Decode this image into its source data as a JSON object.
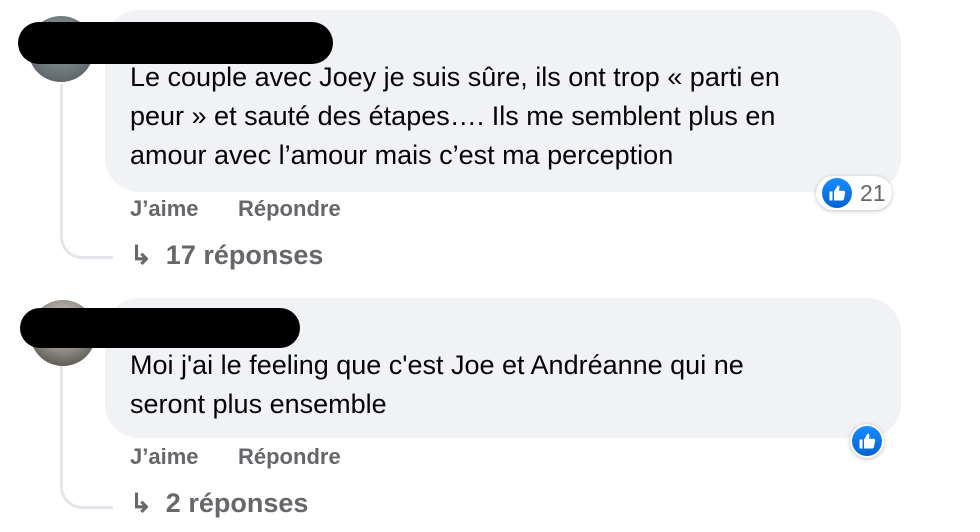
{
  "comments": [
    {
      "text": "Le couple avec Joey je suis sûre, ils ont trop « parti en\npeur » et sauté des étapes…. Ils me semblent plus en\namour avec l’amour mais c’est ma perception",
      "like_label": "J’aime",
      "reply_label": "Répondre",
      "reaction_count": "21",
      "reaction_icon": "like-icon",
      "replies_arrow": "↳",
      "replies_label": "17 réponses"
    },
    {
      "text": "Moi j'ai le feeling que c'est Joe et Andréanne qui ne\nseront plus ensemble",
      "like_label": "J’aime",
      "reply_label": "Répondre",
      "reaction_icon": "like-icon",
      "replies_arrow": "↳",
      "replies_label": "2 réponses"
    }
  ],
  "colors": {
    "like_blue": "#0866ff",
    "bubble_bg": "#f0f2f5",
    "meta_grey": "#65676b"
  }
}
